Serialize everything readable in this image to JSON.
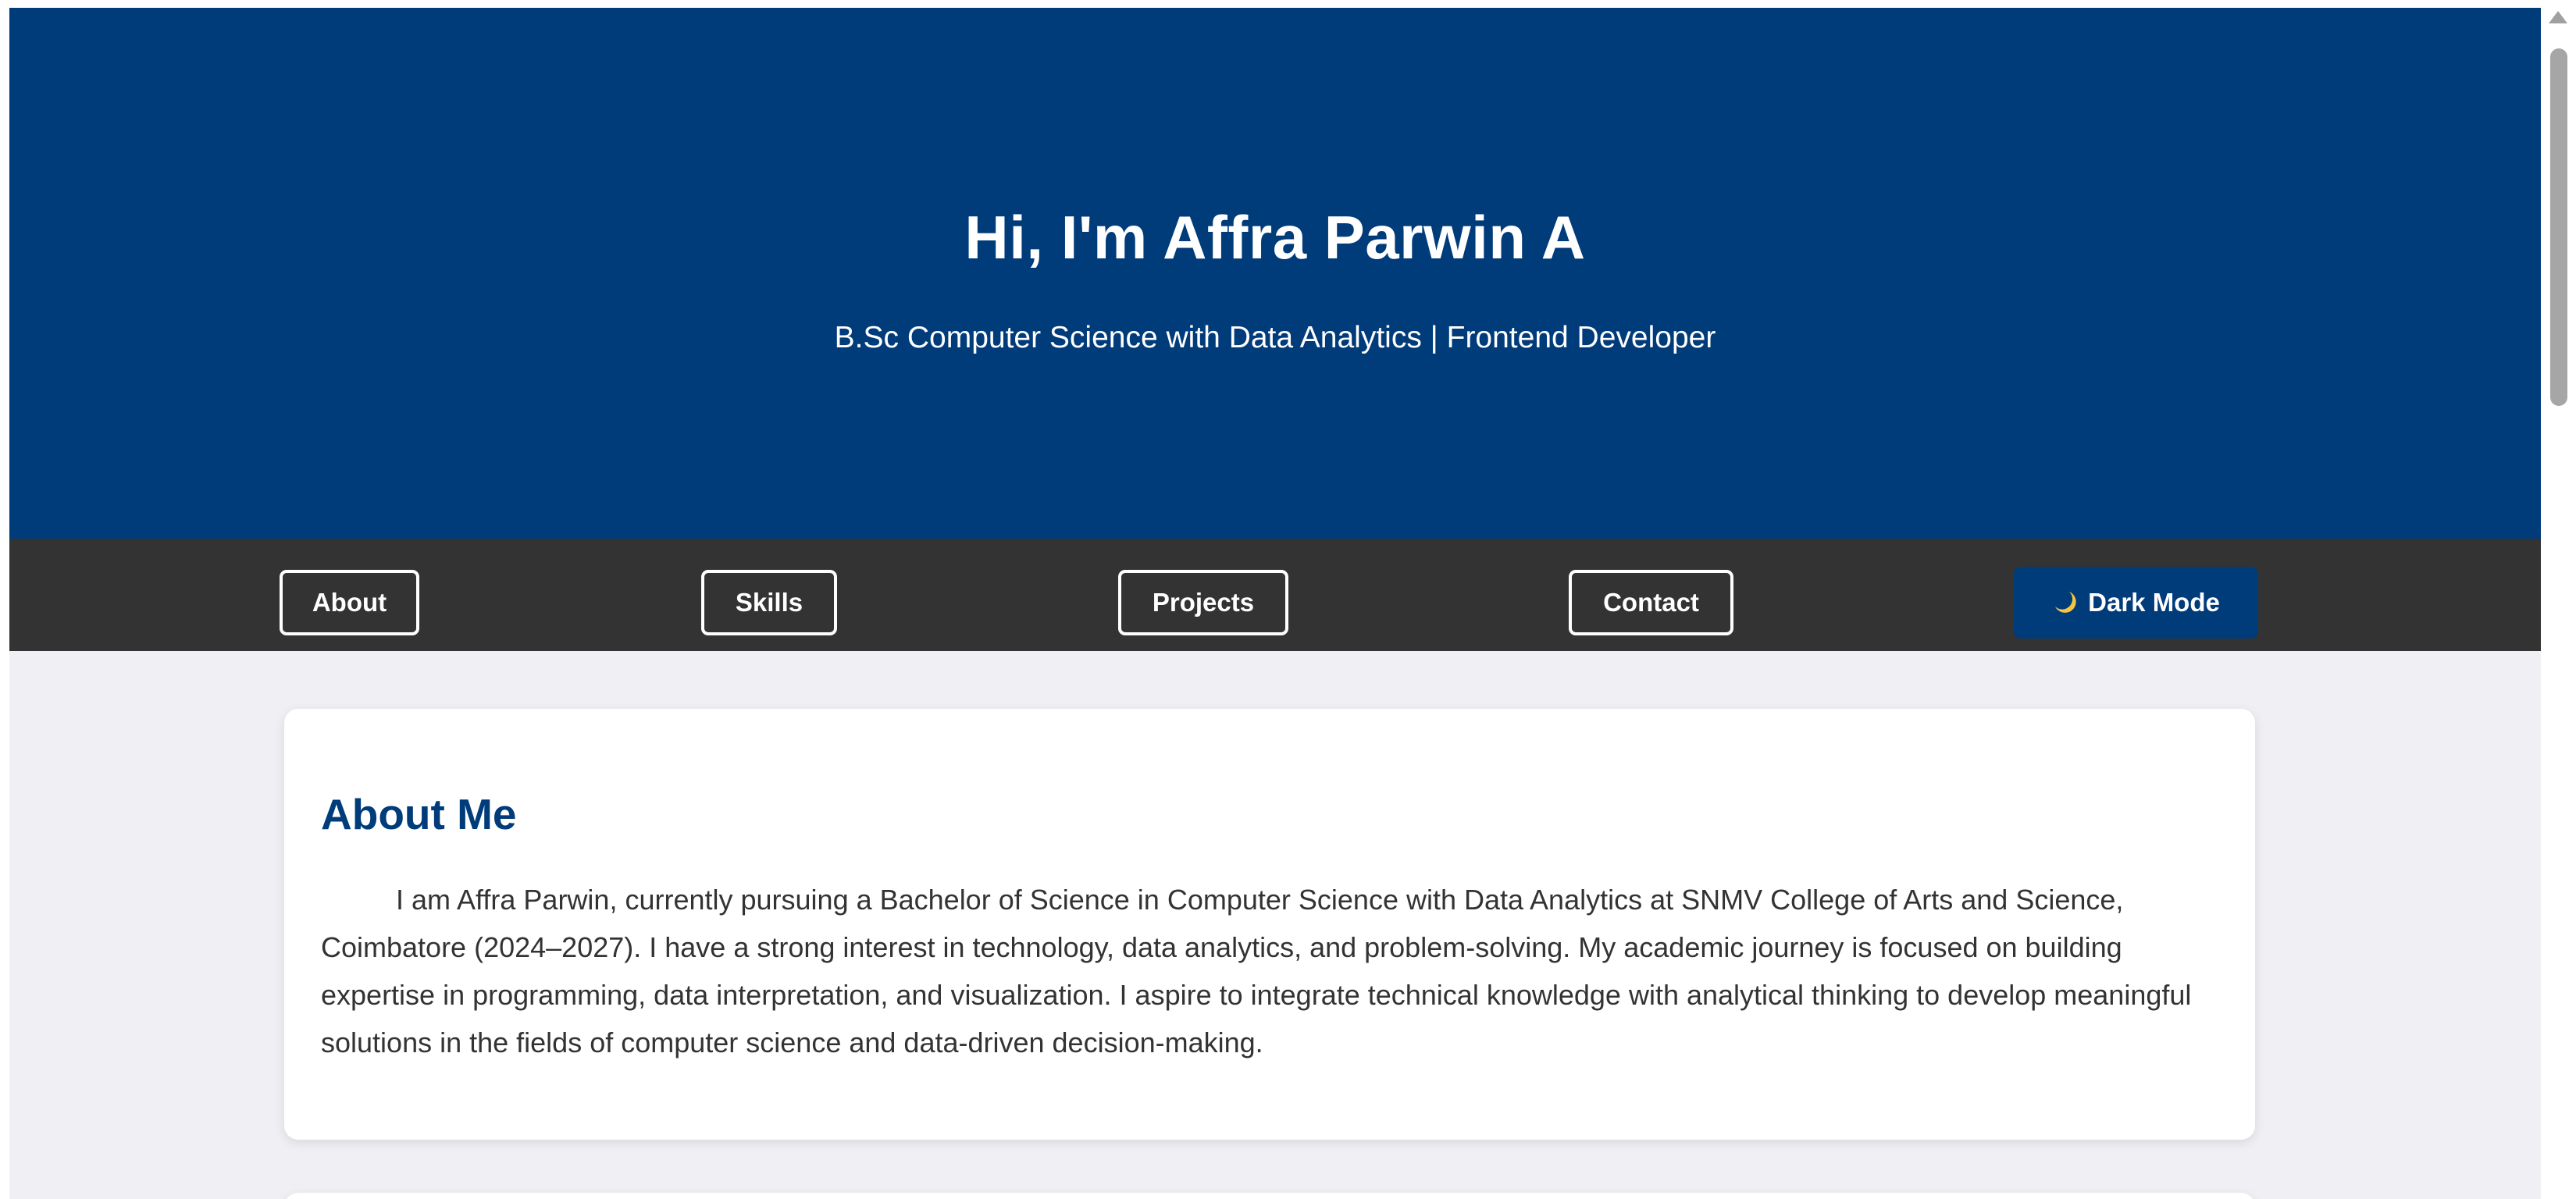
{
  "hero": {
    "title": "Hi, I'm Affra Parwin A",
    "subtitle": "B.Sc Computer Science with Data Analytics | Frontend Developer"
  },
  "nav": {
    "items": [
      {
        "label": "About"
      },
      {
        "label": "Skills"
      },
      {
        "label": "Projects"
      },
      {
        "label": "Contact"
      }
    ],
    "dark_mode": {
      "label": "Dark Mode",
      "icon": "moon-icon"
    }
  },
  "about": {
    "title": "About Me",
    "text": "I am Affra Parwin, currently pursuing a Bachelor of Science in Computer Science with Data Analytics at SNMV College of Arts and Science, Coimbatore (2024–2027). I have a strong interest in technology, data analytics, and problem-solving. My academic journey is focused on building expertise in programming, data interpretation, and visualization. I aspire to integrate technical knowledge with analytical thinking to develop meaningful solutions in the fields of computer science and data-driven decision-making."
  },
  "colors": {
    "primary": "#003b7a",
    "navbar": "#333333",
    "background": "#f0f0f4",
    "card": "#ffffff",
    "text": "#333333"
  }
}
